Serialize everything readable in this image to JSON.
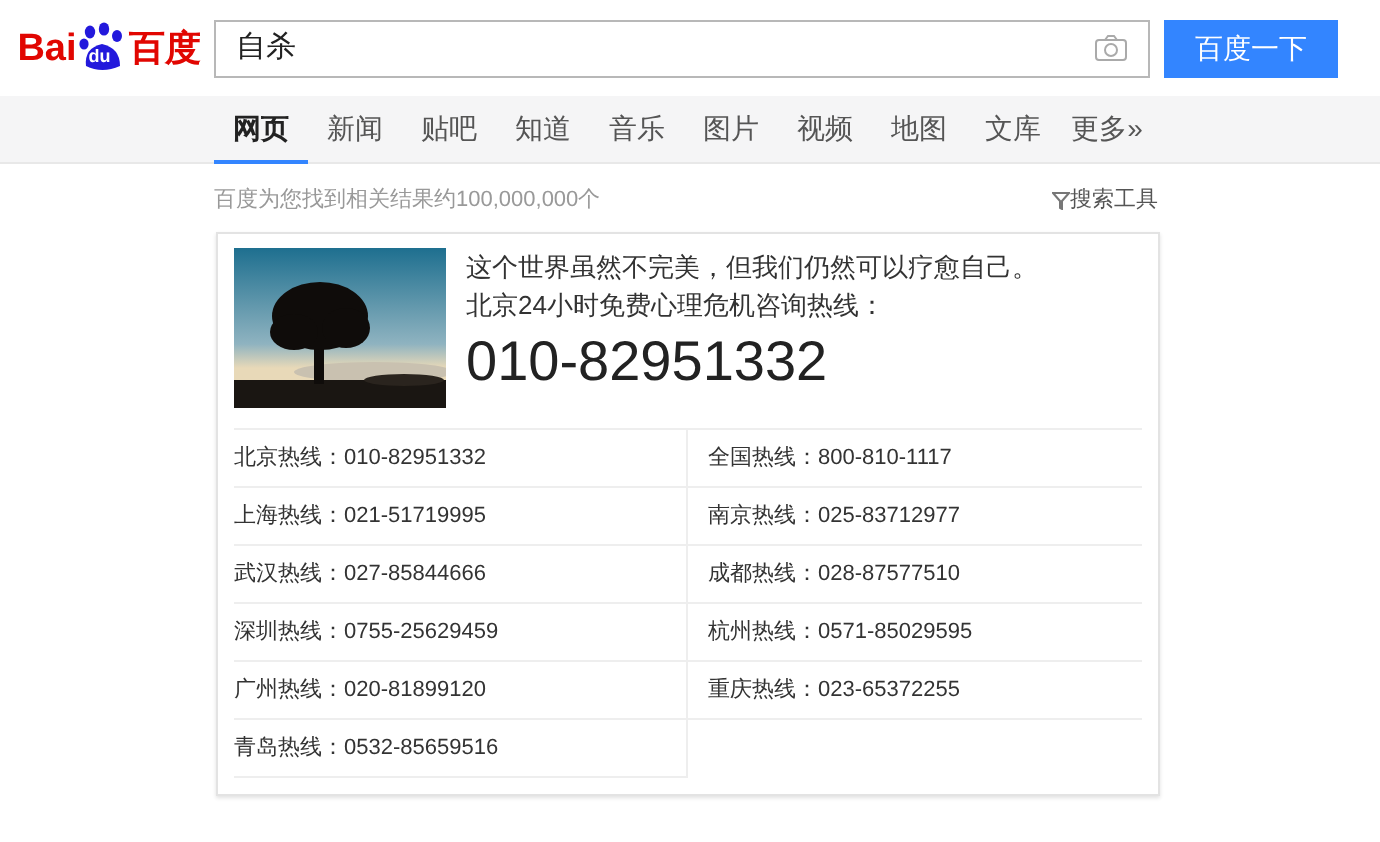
{
  "logo": {
    "part_1": "Bai",
    "part_2": "du",
    "part_3": "百度"
  },
  "search": {
    "value": "自杀",
    "button": "百度一下"
  },
  "tabs": [
    {
      "label": "网页",
      "selected": true
    },
    {
      "label": "新闻",
      "selected": false
    },
    {
      "label": "贴吧",
      "selected": false
    },
    {
      "label": "知道",
      "selected": false
    },
    {
      "label": "音乐",
      "selected": false
    },
    {
      "label": "图片",
      "selected": false
    },
    {
      "label": "视频",
      "selected": false
    },
    {
      "label": "地图",
      "selected": false
    },
    {
      "label": "文库",
      "selected": false
    },
    {
      "label": "更多»",
      "selected": false
    }
  ],
  "result_count": "百度为您找到相关结果约100,000,000个",
  "search_tools": "搜索工具",
  "card": {
    "line_1": "这个世界虽然不完美，但我们仍然可以疗愈自己。",
    "line_2": "北京24小时免费心理危机咨询热线：",
    "phone": "010-82951332",
    "hotlines": [
      {
        "city": "北京热线：",
        "number": "010-82951332"
      },
      {
        "city": "全国热线：",
        "number": "800-810-1117"
      },
      {
        "city": "上海热线：",
        "number": "021-51719995"
      },
      {
        "city": "南京热线：",
        "number": "025-83712977"
      },
      {
        "city": "武汉热线：",
        "number": "027-85844666"
      },
      {
        "city": "成都热线：",
        "number": "028-87577510"
      },
      {
        "city": "深圳热线：",
        "number": "0755-25629459"
      },
      {
        "city": "杭州热线：",
        "number": "0571-85029595"
      },
      {
        "city": "广州热线：",
        "number": "020-81899120"
      },
      {
        "city": "重庆热线：",
        "number": "023-65372255"
      },
      {
        "city": "青岛热线：",
        "number": "0532-85659516"
      }
    ]
  }
}
